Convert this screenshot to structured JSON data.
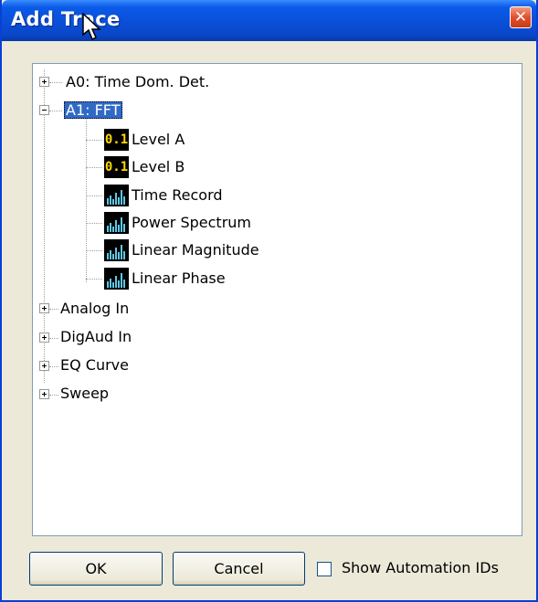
{
  "window": {
    "title": "Add Trace",
    "close_icon": "close-icon"
  },
  "tree": {
    "nodes": [
      {
        "label": "A0: Time Dom. Det.",
        "expanded": false
      },
      {
        "label": "A1: FFT",
        "expanded": true,
        "selected": true,
        "children": [
          {
            "label": "Level A",
            "icon": "meter-value-icon",
            "icon_text": "0.1"
          },
          {
            "label": "Level B",
            "icon": "meter-value-icon",
            "icon_text": "0.1"
          },
          {
            "label": "Time Record",
            "icon": "waveform-icon"
          },
          {
            "label": "Power Spectrum",
            "icon": "waveform-icon"
          },
          {
            "label": "Linear Magnitude",
            "icon": "waveform-icon"
          },
          {
            "label": "Linear Phase",
            "icon": "waveform-icon"
          }
        ]
      },
      {
        "label": "Analog In",
        "expanded": false
      },
      {
        "label": "DigAud In",
        "expanded": false
      },
      {
        "label": "EQ Curve",
        "expanded": false
      },
      {
        "label": "Sweep",
        "expanded": false
      }
    ]
  },
  "footer": {
    "ok_label": "OK",
    "cancel_label": "Cancel",
    "automation_ids_label": "Show Automation IDs",
    "automation_ids_checked": false
  },
  "colors": {
    "titlebar": "#0a4fd8",
    "selection": "#316ac5",
    "icon_value_text": "#ffd800",
    "icon_wave": "#5ec8e8"
  }
}
